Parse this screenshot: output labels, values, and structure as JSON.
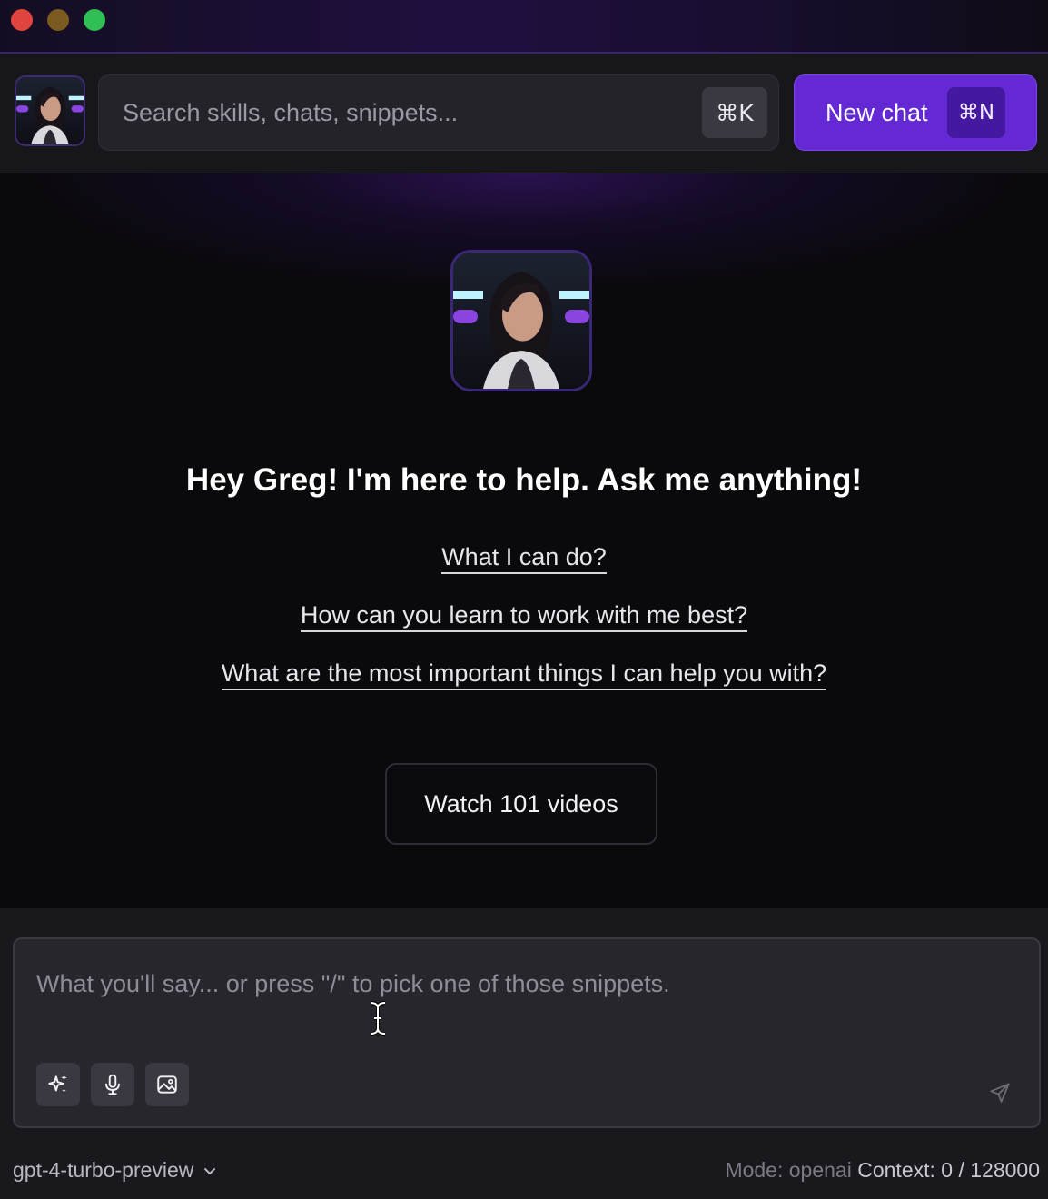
{
  "header": {
    "search_placeholder": "Search skills, chats, snippets...",
    "search_shortcut": "⌘K",
    "new_chat_label": "New chat",
    "new_chat_shortcut": "⌘N"
  },
  "main": {
    "greeting": "Hey Greg! I'm here to help. Ask me anything!",
    "suggestions": [
      "What I can do?",
      "How can you learn to work with me best?",
      "What are the most important things I can help you with?"
    ],
    "watch_button": "Watch 101 videos"
  },
  "composer": {
    "placeholder": "What you'll say... or press \"/\" to pick one of those snippets.",
    "tools": [
      "sparkles-icon",
      "microphone-icon",
      "image-icon"
    ]
  },
  "footer": {
    "model": "gpt-4-turbo-preview",
    "mode_label": "Mode:",
    "mode_value": "openai",
    "context_label": "Context:",
    "context_value": "0 / 128000"
  },
  "colors": {
    "accent": "#6428d4",
    "background": "#0a090c",
    "panel": "#19181d"
  }
}
